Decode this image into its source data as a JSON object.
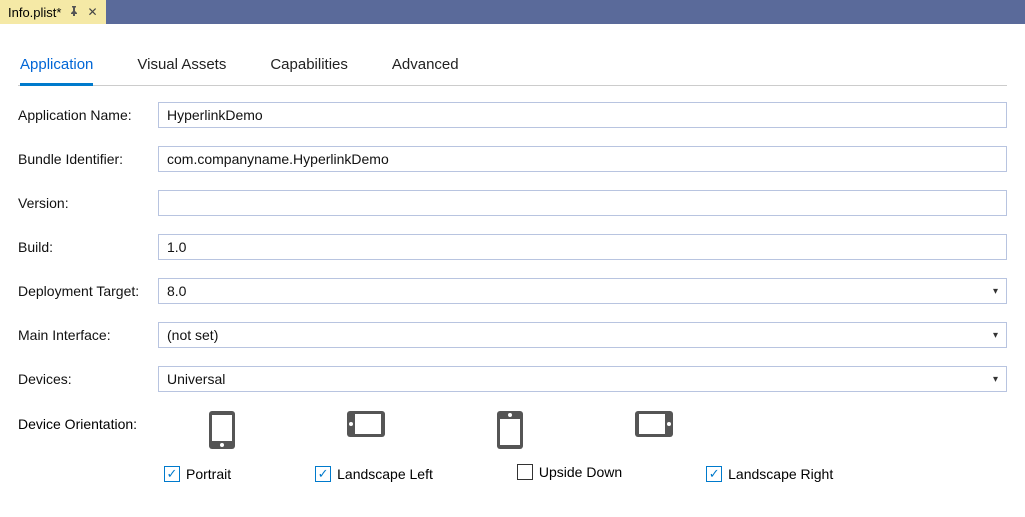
{
  "file_tab": {
    "name": "Info.plist*"
  },
  "tabs": {
    "application": "Application",
    "visual_assets": "Visual Assets",
    "capabilities": "Capabilities",
    "advanced": "Advanced"
  },
  "labels": {
    "app_name": "Application Name:",
    "bundle_id": "Bundle Identifier:",
    "version": "Version:",
    "build": "Build:",
    "deployment": "Deployment Target:",
    "main_interface": "Main Interface:",
    "devices": "Devices:",
    "orientation": "Device Orientation:"
  },
  "values": {
    "app_name": "HyperlinkDemo",
    "bundle_id": "com.companyname.HyperlinkDemo",
    "version": "",
    "build": "1.0",
    "deployment": "8.0",
    "main_interface": "(not set)",
    "devices": "Universal"
  },
  "orientation": {
    "portrait": {
      "label": "Portrait",
      "checked": true
    },
    "landscape_left": {
      "label": "Landscape Left",
      "checked": true
    },
    "upside_down": {
      "label": "Upside Down",
      "checked": false
    },
    "landscape_right": {
      "label": "Landscape Right",
      "checked": true
    }
  }
}
